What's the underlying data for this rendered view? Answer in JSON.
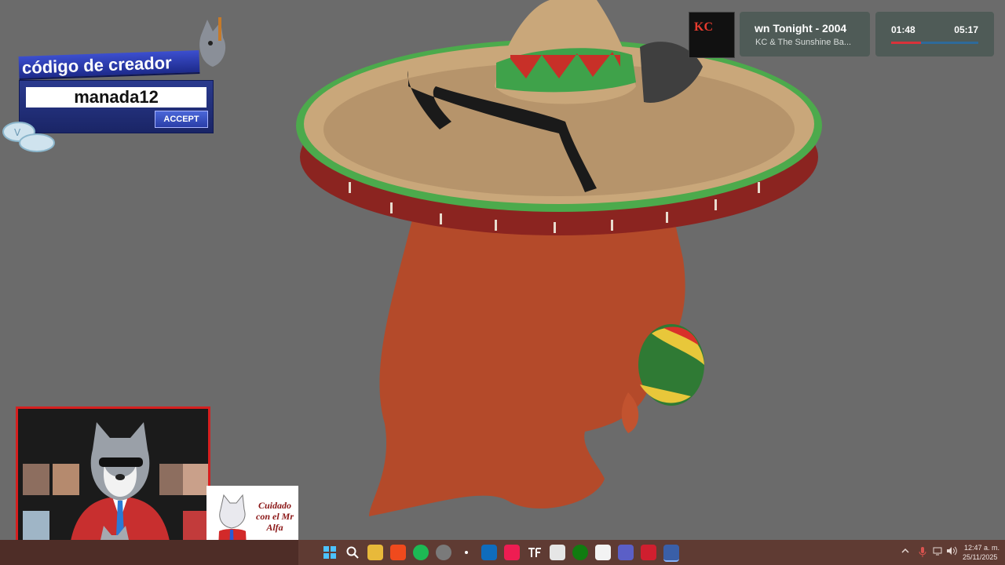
{
  "creator_code": {
    "title": "código de creador",
    "code": "manada12",
    "accept_label": "ACCEPT"
  },
  "now_playing": {
    "album_art_text": "KC",
    "title": "wn Tonight - 2004",
    "artist": "KC & The Sunshine Ba...",
    "elapsed": "01:48",
    "total": "05:17",
    "progress_fraction": 0.34
  },
  "sticker": {
    "text": "Cuidado con el Mr Alfa"
  },
  "taskbar": {
    "apps": [
      {
        "icon": "windows-start-icon"
      },
      {
        "icon": "search-icon"
      },
      {
        "icon": "file-explorer-icon"
      },
      {
        "icon": "brave-icon"
      },
      {
        "icon": "spotify-icon"
      },
      {
        "icon": "chrome-icon"
      },
      {
        "icon": "app-icon"
      },
      {
        "icon": "outlook-icon"
      },
      {
        "icon": "tiktok-icon"
      },
      {
        "icon": "tf-app-icon"
      },
      {
        "icon": "capcut-icon"
      },
      {
        "icon": "xbox-icon"
      },
      {
        "icon": "ms-store-icon"
      },
      {
        "icon": "teams-icon"
      },
      {
        "icon": "flash-icon"
      },
      {
        "icon": "active-app-icon"
      }
    ],
    "time": "12:47 a. m.",
    "date": "25/11/2025"
  },
  "colors": {
    "background": "#6b6b6b",
    "hat_straw": "#c9a77a",
    "hat_rim_green": "#4caa4c",
    "hat_rim_red": "#8b2420",
    "body": "#b44a2a",
    "cam_border": "#d61f1f",
    "taskbar": "#5f3b33"
  }
}
